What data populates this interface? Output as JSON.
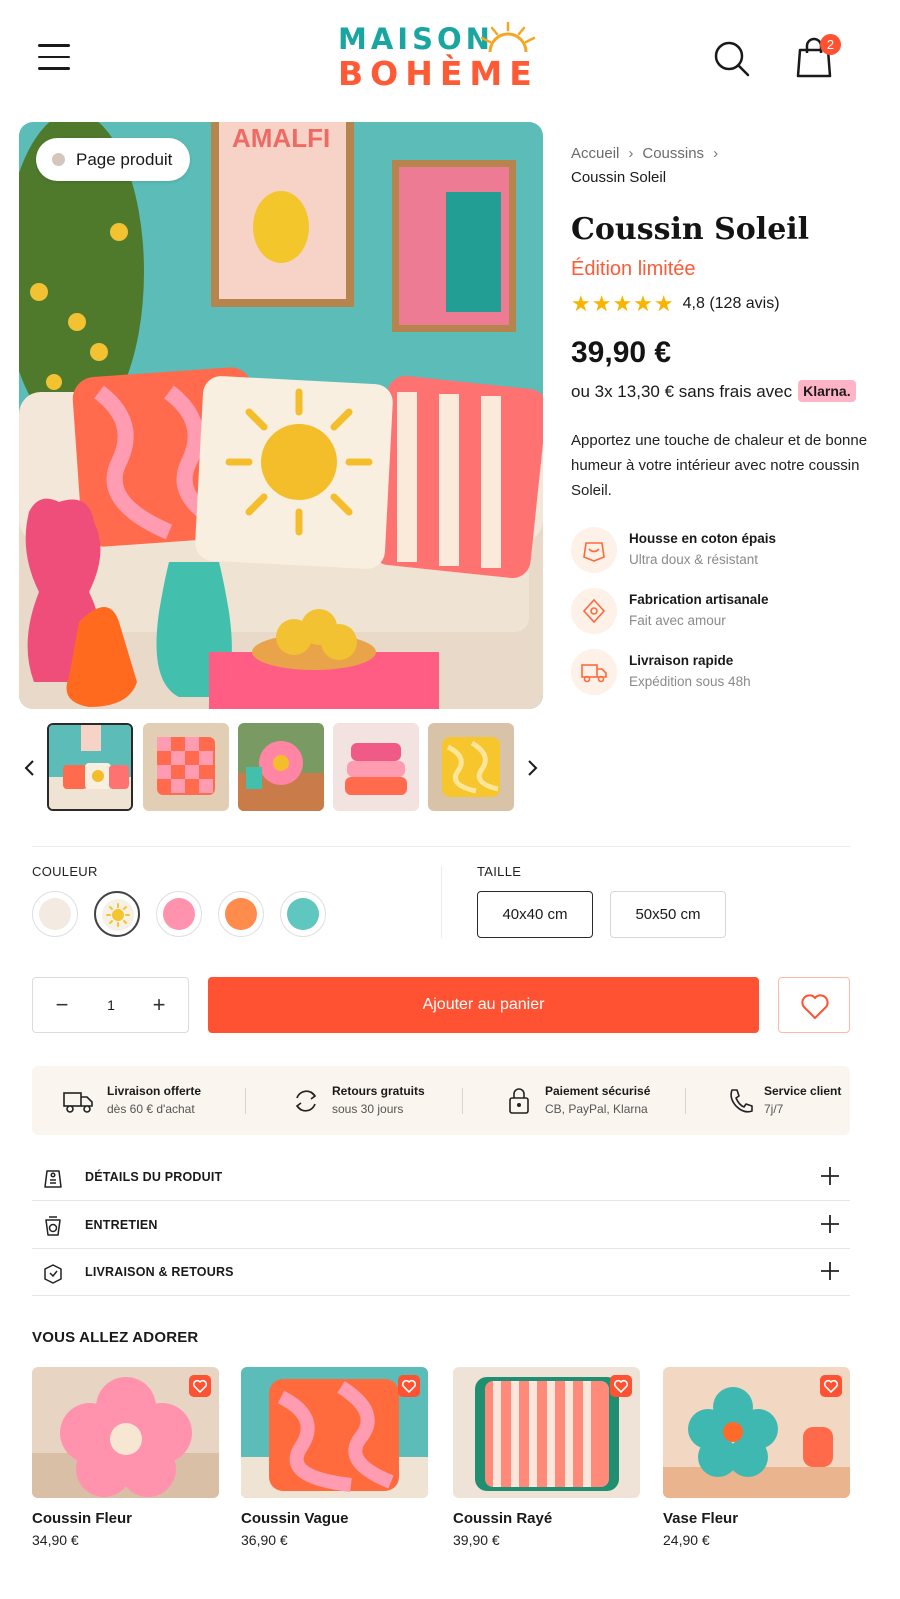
{
  "header": {
    "logo_top": "MAISON",
    "logo_bottom": "BOHÈME",
    "cart_count": "2"
  },
  "gallery": {
    "badge": "Page produit",
    "thumb_count": 5
  },
  "product": {
    "breadcrumb": [
      "Accueil",
      "Coussins",
      "Coussin Soleil"
    ],
    "title": "Coussin Soleil",
    "subtitle": "Édition limitée",
    "stars": "★★★★★",
    "rating_text": "4,8 (128 avis)",
    "price": "39,90 €",
    "installments": "ou 3x 13,30 € sans frais avec",
    "klarna": "Klarna.",
    "description": "Apportez une touche de chaleur et de bonne humeur à votre intérieur avec notre coussin Soleil.",
    "features": [
      {
        "icon": "fabric-icon",
        "title": "Housse en coton épais",
        "sub": "Ultra doux & résistant"
      },
      {
        "icon": "handmade-icon",
        "title": "Fabrication artisanale",
        "sub": "Fait avec amour"
      },
      {
        "icon": "delivery-truck-icon",
        "title": "Livraison rapide",
        "sub": "Expédition sous 48h"
      }
    ]
  },
  "options": {
    "color_label": "COULEUR",
    "colors": [
      "#f3ebe1",
      "#f5c431",
      "#ff93ad",
      "#ff8c4d",
      "#5fc6c0"
    ],
    "selected_color": 1,
    "size_label": "TAILLE",
    "sizes": [
      "40x40 cm",
      "50x50 cm"
    ],
    "selected_size": 0
  },
  "cart": {
    "quantity": "1",
    "minus": "−",
    "plus": "+",
    "add_label": "Ajouter au panier"
  },
  "benefits": [
    {
      "icon": "truck-icon",
      "title": "Livraison offerte",
      "sub": "dès 60 € d'achat"
    },
    {
      "icon": "return-arrows-icon",
      "title": "Retours gratuits",
      "sub": "sous 30 jours"
    },
    {
      "icon": "lock-icon",
      "title": "Paiement sécurisé",
      "sub": "CB, PayPal, Klarna"
    },
    {
      "icon": "phone-icon",
      "title": "Service client",
      "sub": "7j/7"
    }
  ],
  "accordion": [
    {
      "icon": "tag-icon",
      "label": "DÉTAILS DU PRODUIT"
    },
    {
      "icon": "washing-icon",
      "label": "ENTRETIEN"
    },
    {
      "icon": "package-icon",
      "label": "LIVRAISON & RETOURS"
    }
  ],
  "recommendations": {
    "title": "VOUS ALLEZ ADORER",
    "items": [
      {
        "name": "Coussin Fleur",
        "price": "34,90 €"
      },
      {
        "name": "Coussin Vague",
        "price": "36,90 €"
      },
      {
        "name": "Coussin Rayé",
        "price": "39,90 €"
      },
      {
        "name": "Vase Fleur",
        "price": "24,90 €"
      }
    ]
  },
  "colors": {
    "accent": "#ff5233",
    "teal": "#1aa6a0",
    "star": "#f7b500",
    "klarna_pink": "#ffb3c7"
  }
}
